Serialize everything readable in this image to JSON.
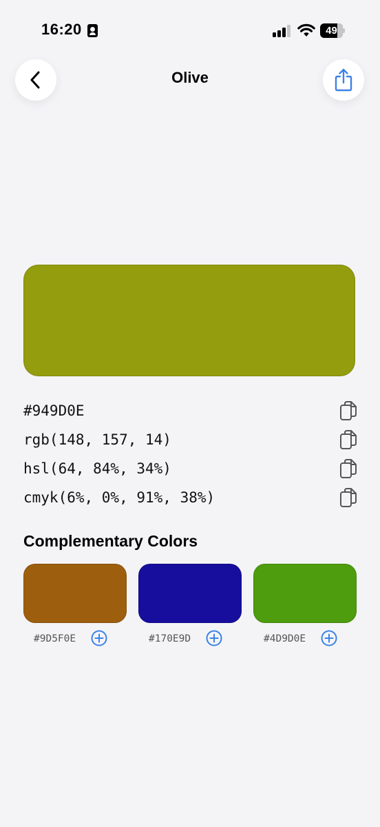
{
  "status_bar": {
    "time": "16:20",
    "battery_level": "49",
    "battery_fraction": 0.49
  },
  "header": {
    "title": "Olive",
    "back_icon": "chevron-left-icon",
    "share_icon": "share-icon"
  },
  "color": {
    "hex_color": "#949D0E",
    "values": [
      {
        "text": "#949D0E",
        "icon": "copy-icon"
      },
      {
        "text": "rgb(148, 157, 14)",
        "icon": "copy-icon"
      },
      {
        "text": "hsl(64, 84%, 34%)",
        "icon": "copy-icon"
      },
      {
        "text": "cmyk(6%, 0%, 91%, 38%)",
        "icon": "copy-icon"
      }
    ]
  },
  "complementary": {
    "title": "Complementary Colors",
    "colors": [
      {
        "hex": "#9D5F0E",
        "swatch": "#9D5F0E",
        "icon": "plus-circle-icon"
      },
      {
        "hex": "#170E9D",
        "swatch": "#170E9D",
        "icon": "plus-circle-icon"
      },
      {
        "hex": "#4D9D0E",
        "swatch": "#4D9D0E",
        "icon": "plus-circle-icon"
      }
    ]
  },
  "accent_color": "#3b82e6"
}
